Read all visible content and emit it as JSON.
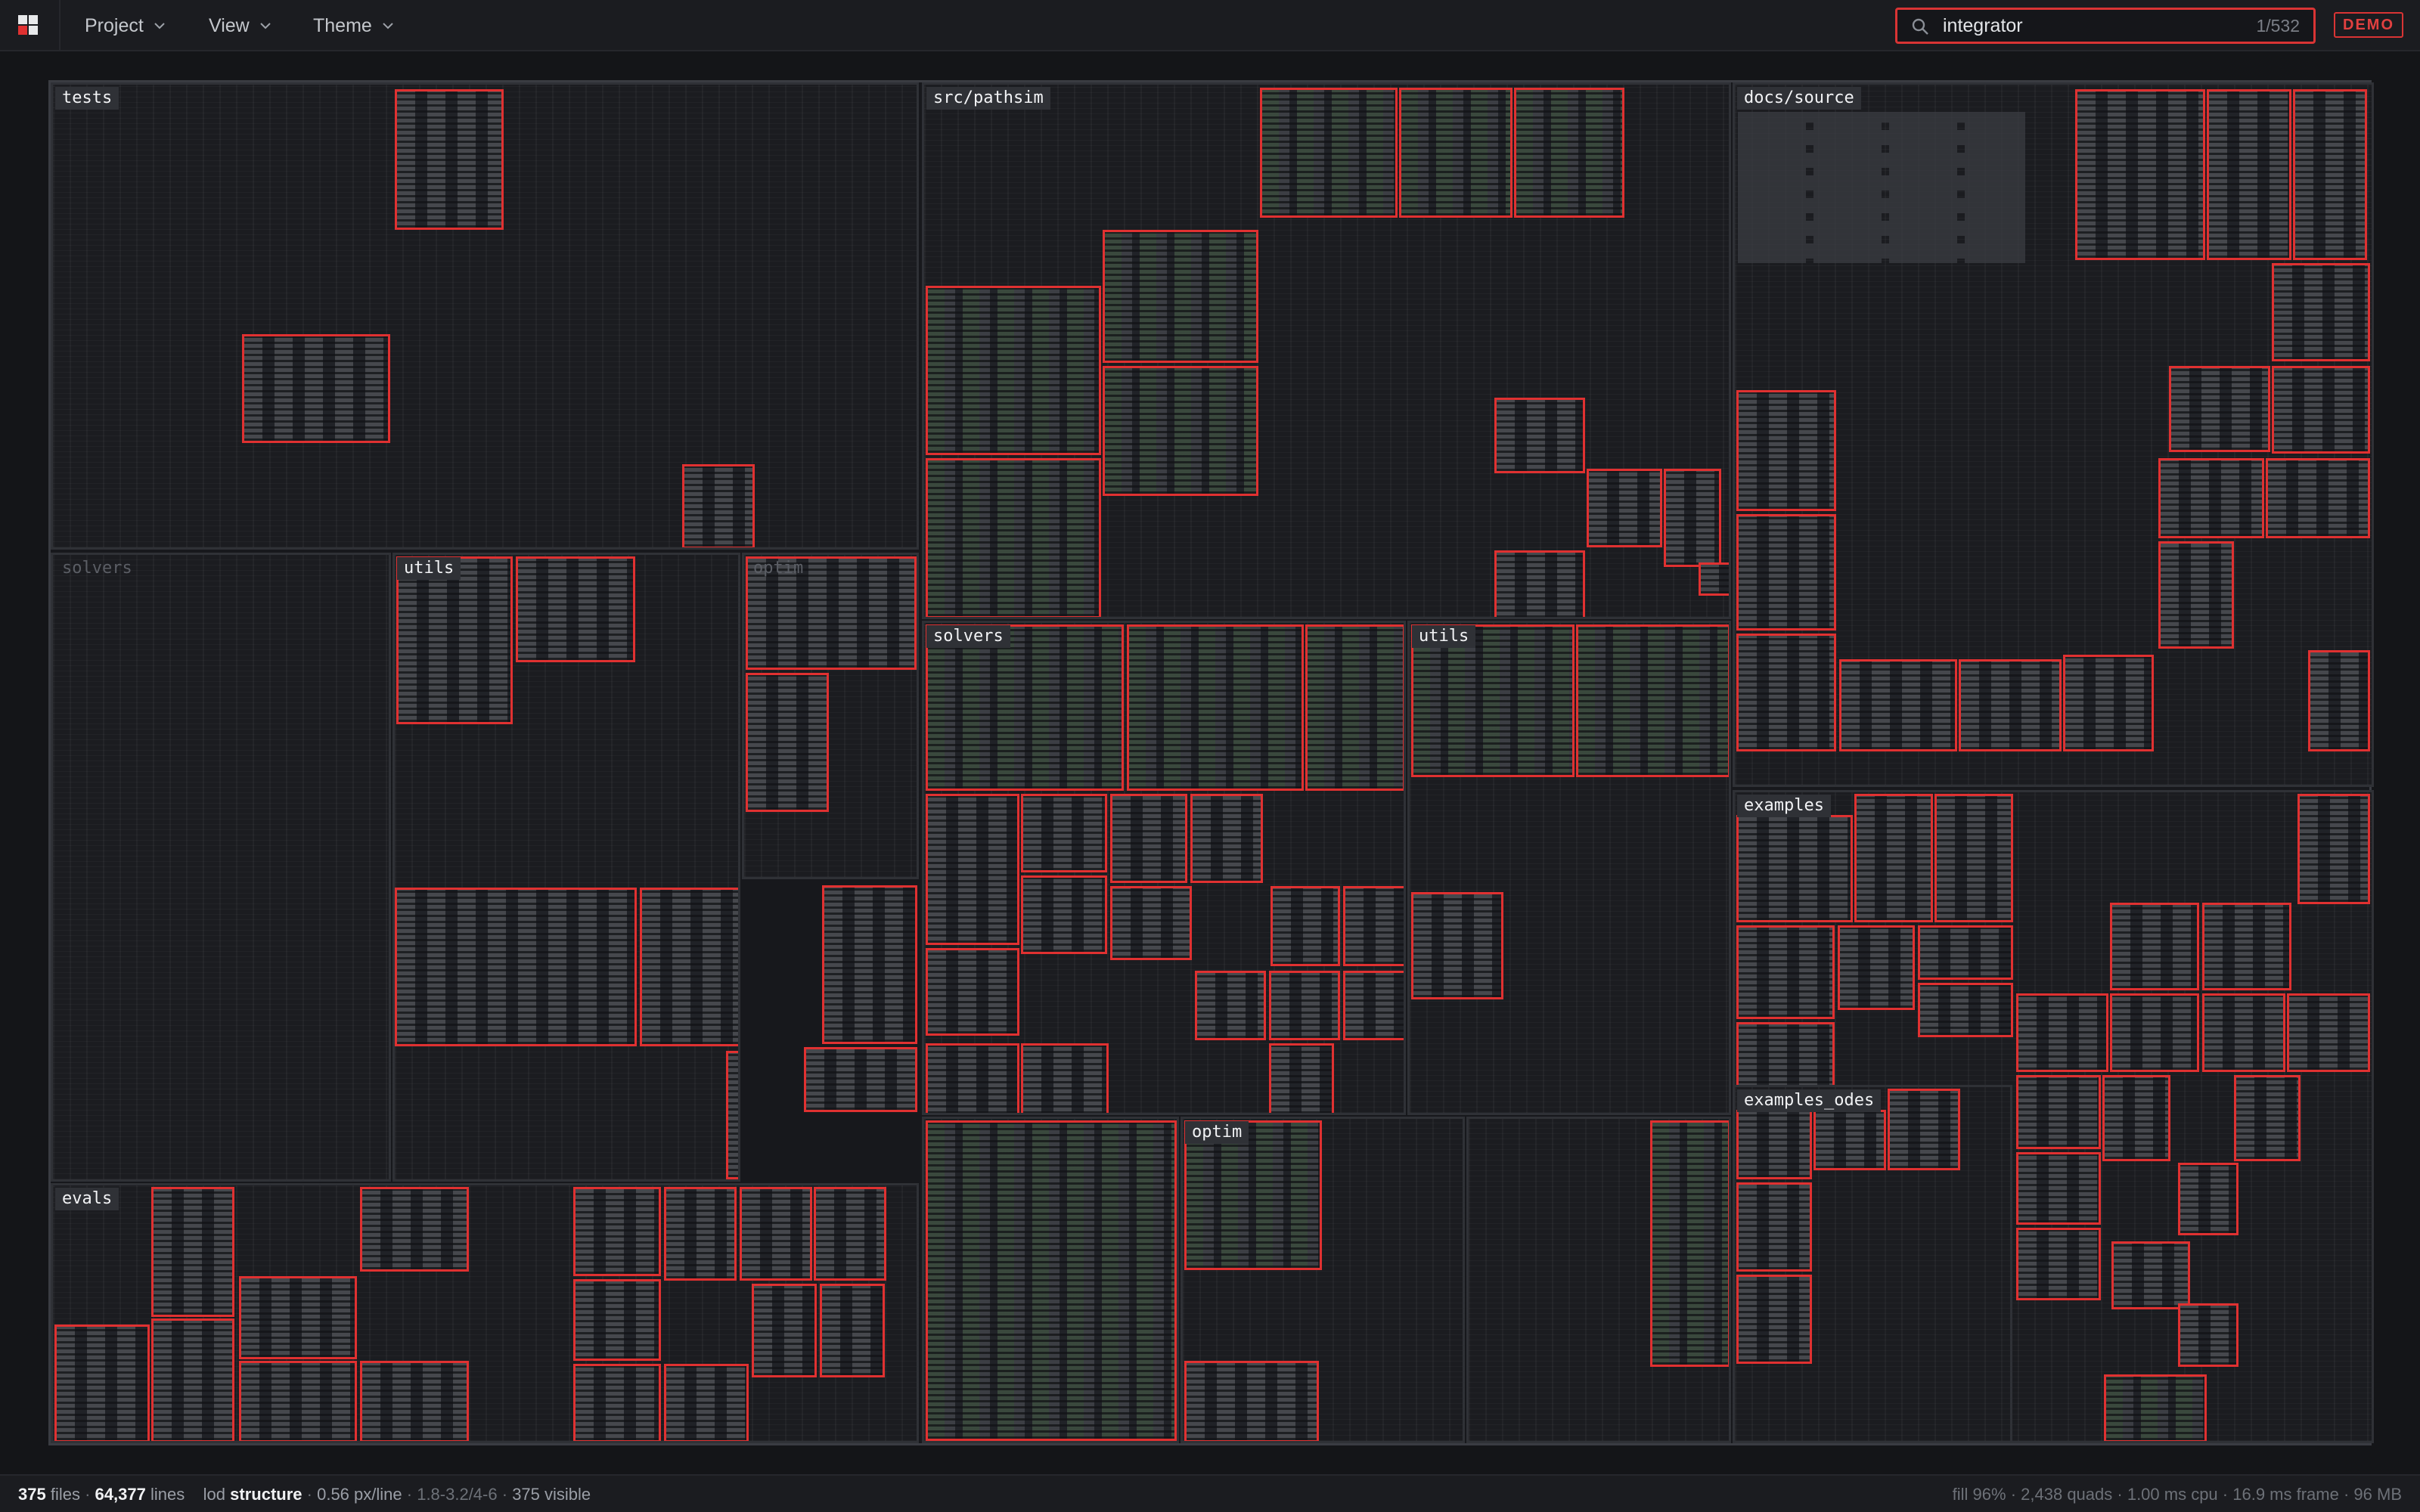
{
  "app": {
    "menus": {
      "project": "Project",
      "view": "View",
      "theme": "Theme"
    },
    "search": {
      "value": "integrator",
      "count": "1/532"
    },
    "badge": "DEMO"
  },
  "regions": {
    "tests": "tests",
    "solvers_left": "solvers",
    "utils_left": "utils",
    "optim_left": "optim",
    "evals": "evals",
    "src_pathsim": "src/pathsim",
    "solvers_mid": "solvers",
    "utils_mid": "utils",
    "optim_mid": "optim",
    "docs_source": "docs/source",
    "examples": "examples",
    "examples_odes": "examples_odes"
  },
  "status": {
    "files": "375",
    "files_label": "files",
    "lines": "64,377",
    "lines_label": "lines",
    "lod_label": "lod",
    "lod": "structure",
    "px_per_line": "0.56 px/line",
    "range": "1.8-3.2/4-6",
    "visible": "375 visible",
    "fill": "fill 96%",
    "quads": "2,438 quads",
    "cpu": "1.00 ms cpu",
    "frame": "16.9 ms frame",
    "memory": "96 MB"
  },
  "colors": {
    "accent": "#e03131",
    "background": "#141518",
    "panel": "#1b1c20",
    "border": "#2f3136"
  },
  "icons": [
    "app-logo-icon",
    "chevron-down-icon",
    "search-icon"
  ]
}
